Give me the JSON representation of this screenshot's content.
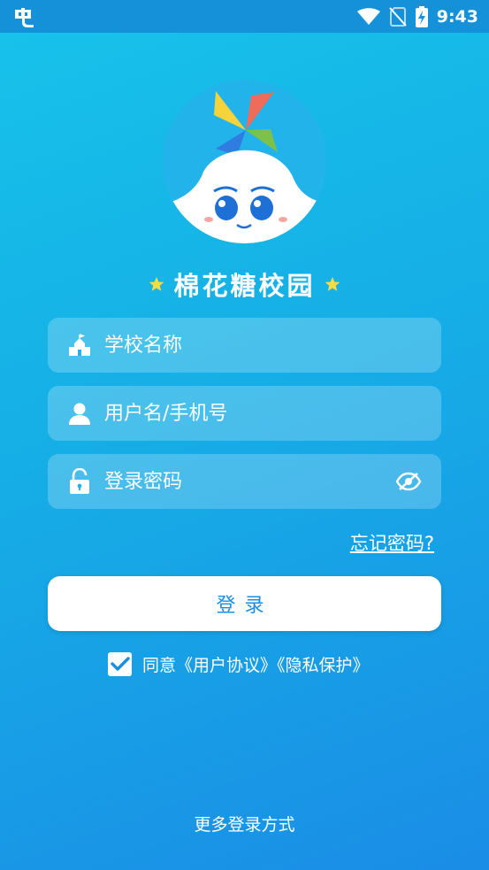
{
  "status_bar": {
    "time": "9:43"
  },
  "brand": {
    "name": "棉花糖校园"
  },
  "form": {
    "school_placeholder": "学校名称",
    "username_placeholder": "用户名/手机号",
    "password_placeholder": "登录密码",
    "forgot_label": "忘记密码?",
    "login_label": "登录"
  },
  "agreement": {
    "prefix": "同意",
    "user_agreement": "《用户协议》",
    "privacy": "《隐私保护》",
    "checked": true
  },
  "more_login_label": "更多登录方式",
  "colors": {
    "bg_top": "#17c3ea",
    "bg_bottom": "#1a8de6",
    "button_text": "#1a8fe0"
  }
}
